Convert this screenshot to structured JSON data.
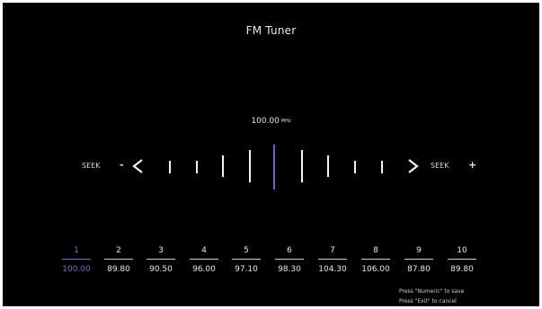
{
  "title": "FM Tuner",
  "frequency": {
    "value": "100.00",
    "unit": "MHz"
  },
  "seek": {
    "left_label": "SEEK",
    "left_sign": "-",
    "right_label": "SEEK",
    "right_sign": "+"
  },
  "icons": {
    "left": "chevron-left-icon",
    "right": "chevron-right-icon"
  },
  "colors": {
    "accent": "#6f72c7",
    "background": "#000000",
    "text": "#e8e8e8"
  },
  "presets": [
    {
      "number": "1",
      "frequency": "100.00",
      "selected": true
    },
    {
      "number": "2",
      "frequency": "89.80"
    },
    {
      "number": "3",
      "frequency": "90.50"
    },
    {
      "number": "4",
      "frequency": "96.00"
    },
    {
      "number": "5",
      "frequency": "97.10"
    },
    {
      "number": "6",
      "frequency": "98.30"
    },
    {
      "number": "7",
      "frequency": "104.30"
    },
    {
      "number": "8",
      "frequency": "106.00"
    },
    {
      "number": "9",
      "frequency": "87.80"
    },
    {
      "number": "10",
      "frequency": "89.80"
    }
  ],
  "hints": {
    "save": "Press \"Numeric\" to save",
    "cancel": "Press \"Exit\" to cancel"
  }
}
